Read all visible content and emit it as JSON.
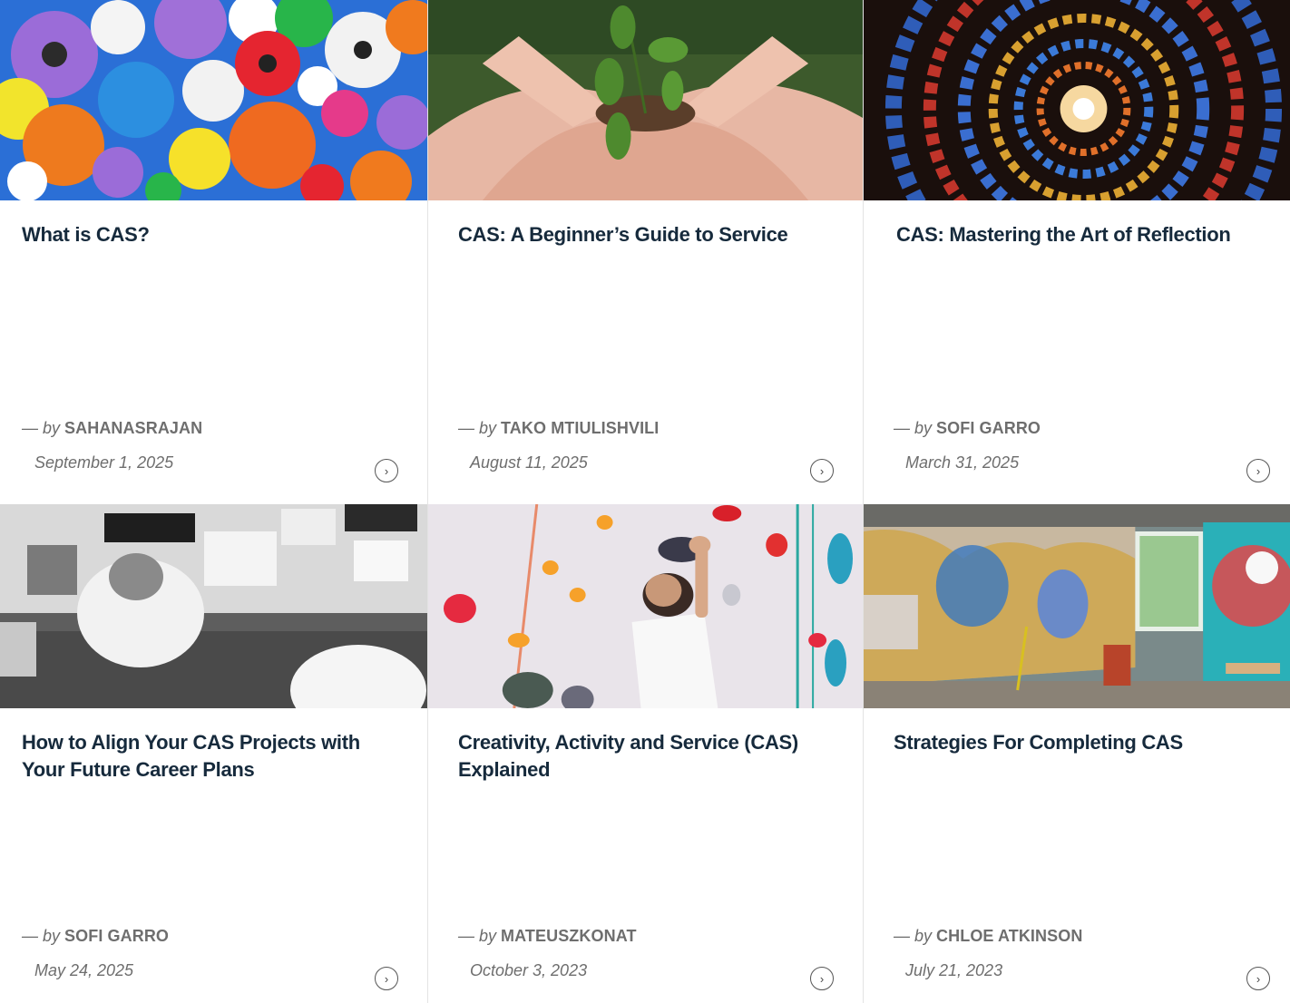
{
  "posts": [
    {
      "title": "What is CAS?",
      "by": "— by",
      "author": "SAHANASRAJAN",
      "date": "September 1, 2025",
      "image": "colorful-gears"
    },
    {
      "title": "CAS: A Beginner’s Guide to Service",
      "by": "— by",
      "author": "TAKO MTIULISHVILI",
      "date": "August 11, 2025",
      "image": "hands-holding-plant"
    },
    {
      "title": "CAS: Mastering the Art of Reflection",
      "by": "— by",
      "author": "SOFI GARRO",
      "date": "March 31, 2025",
      "image": "stained-glass-spiral"
    },
    {
      "title": "How to Align Your CAS Projects with Your Future Career Plans",
      "by": "— by",
      "author": "SOFI GARRO",
      "date": "May 24, 2025",
      "image": "office-desk-overhead"
    },
    {
      "title": "Creativity, Activity and Service (CAS) Explained",
      "by": "— by",
      "author": "MATEUSZKONAT",
      "date": "October 3, 2023",
      "image": "climbing-wall"
    },
    {
      "title": "Strategies For Completing CAS",
      "by": "— by",
      "author": "CHLOE ATKINSON",
      "date": "July 21, 2023",
      "image": "graffiti-studio"
    }
  ],
  "arrow_icon": "chevron-right-circle-icon"
}
